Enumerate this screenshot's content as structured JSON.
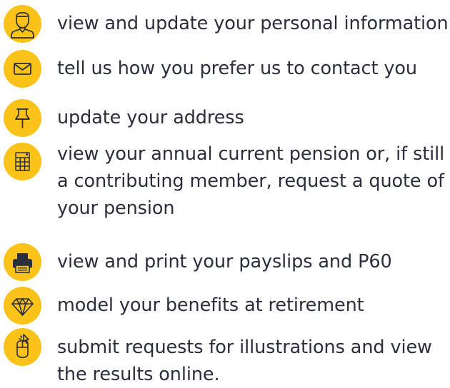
{
  "features": [
    {
      "icon": "person-icon",
      "text": "view and update your personal information"
    },
    {
      "icon": "envelope-icon",
      "text": "tell us how you prefer us to contact you"
    },
    {
      "icon": "pushpin-icon",
      "text": "update your address"
    },
    {
      "icon": "calculator-icon",
      "text": "view your annual current pension or, if still a contributing member, request a quote of your pension"
    },
    {
      "icon": "printer-icon",
      "text": "view and print your payslips and P60"
    },
    {
      "icon": "diamond-icon",
      "text": "model your benefits at retirement"
    },
    {
      "icon": "mouse-icon",
      "text": "submit requests for illustrations and view the results online."
    }
  ],
  "colors": {
    "icon_background": "#fbc31a",
    "icon_stroke": "#2b2e3d",
    "text": "#2b2e3d"
  }
}
